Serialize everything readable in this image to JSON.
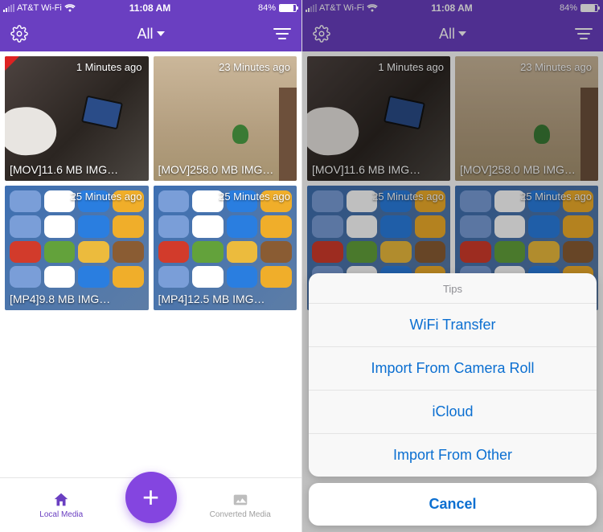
{
  "statusbar": {
    "carrier": "AT&T Wi-Fi",
    "time": "11:08 AM",
    "battery_pct": "84%",
    "battery_fill_pct": 84
  },
  "nav": {
    "title": "All"
  },
  "media": [
    {
      "time": "1 Minutes ago",
      "caption": "[MOV]11.6 MB IMG…"
    },
    {
      "time": "23 Minutes ago",
      "caption": "[MOV]258.0 MB IMG…"
    },
    {
      "time": "25 Minutes ago",
      "caption": "[MP4]9.8 MB IMG…"
    },
    {
      "time": "25 Minutes ago",
      "caption": "[MP4]12.5 MB IMG…"
    }
  ],
  "tabs": {
    "local": "Local Media",
    "converted": "Converted Media"
  },
  "sheet": {
    "title": "Tips",
    "options": [
      "WiFi Transfer",
      "Import From Camera Roll",
      "iCloud",
      "Import From Other"
    ],
    "cancel": "Cancel"
  },
  "colors": {
    "brand": "#6a3fc1",
    "fab": "#8445e0",
    "ios_blue": "#0b6fd1"
  }
}
